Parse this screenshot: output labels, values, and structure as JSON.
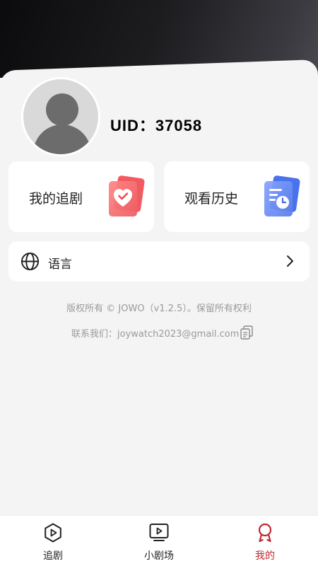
{
  "profile": {
    "uid_text": "UID：37058"
  },
  "cards": {
    "following_label": "我的追剧",
    "history_label": "观看历史"
  },
  "settings": {
    "language_label": "语言"
  },
  "footer": {
    "copyright": "版权所有 © JOWO（v1.2.5）。保留所有权利",
    "contact": "联系我们：joywatch2023@gmail.com"
  },
  "tabbar": {
    "tabs": [
      {
        "label": "追剧",
        "icon": "play-circle-icon",
        "active": false
      },
      {
        "label": "小剧场",
        "icon": "tv-play-icon",
        "active": false
      },
      {
        "label": "我的",
        "icon": "profile-badge-icon",
        "active": true
      }
    ]
  },
  "colors": {
    "accent": "#c0272d",
    "heart_card": "#f0545a",
    "history_card": "#4a78f0"
  }
}
